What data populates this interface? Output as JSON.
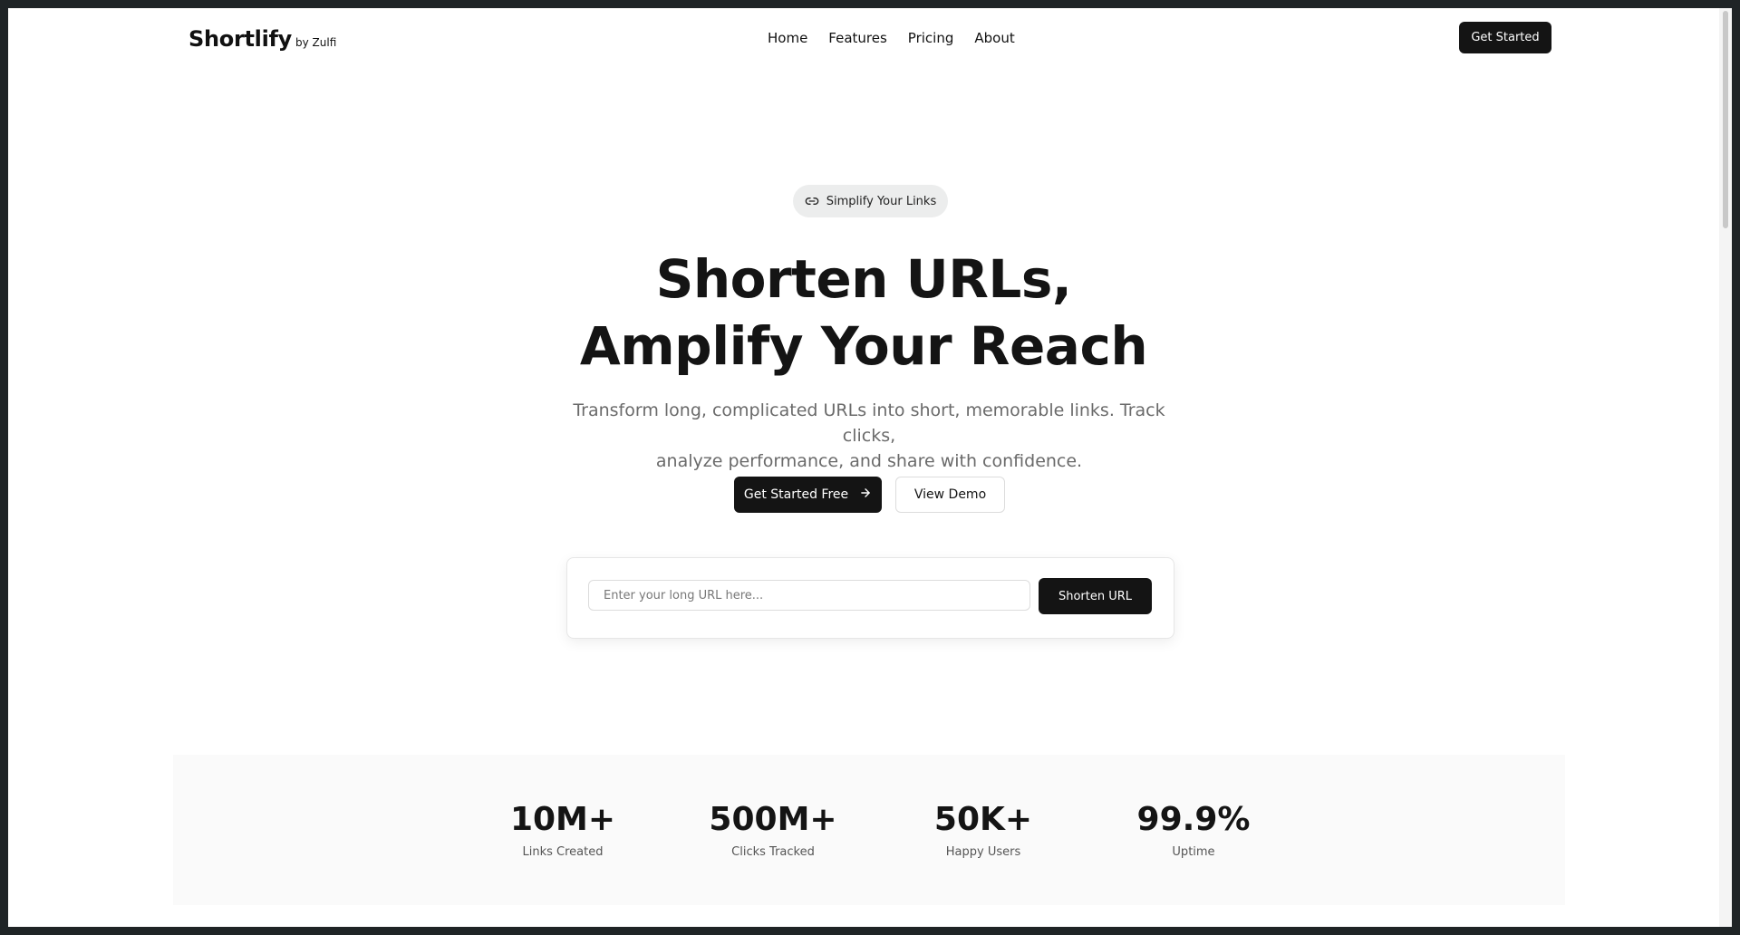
{
  "brand": {
    "name": "Shortlify",
    "by": "by Zulfi"
  },
  "nav": {
    "items": [
      "Home",
      "Features",
      "Pricing",
      "About"
    ],
    "cta": "Get Started"
  },
  "hero": {
    "pill_icon": "link-icon",
    "pill_label": "Simplify Your Links",
    "title_line1": "Shorten URLs,",
    "title_line2": "Amplify Your Reach",
    "subtitle_line1": "Transform long, complicated URLs into short, memorable links. Track clicks,",
    "subtitle_line2": "analyze performance, and share with confidence.",
    "primary_button": "Get Started Free",
    "primary_button_icon": "arrow-right-icon",
    "secondary_button": "View Demo"
  },
  "shortener": {
    "placeholder": "Enter your long URL here...",
    "value": "",
    "button": "Shorten URL"
  },
  "stats": [
    {
      "value": "10M+",
      "label": "Links Created"
    },
    {
      "value": "500M+",
      "label": "Clicks Tracked"
    },
    {
      "value": "50K+",
      "label": "Happy Users"
    },
    {
      "value": "99.9%",
      "label": "Uptime"
    }
  ],
  "colors": {
    "primary": "#141414",
    "background": "#ffffff",
    "pill_bg": "#eceded",
    "muted_text": "#6a6a6a",
    "stats_bg": "#fafafa"
  }
}
